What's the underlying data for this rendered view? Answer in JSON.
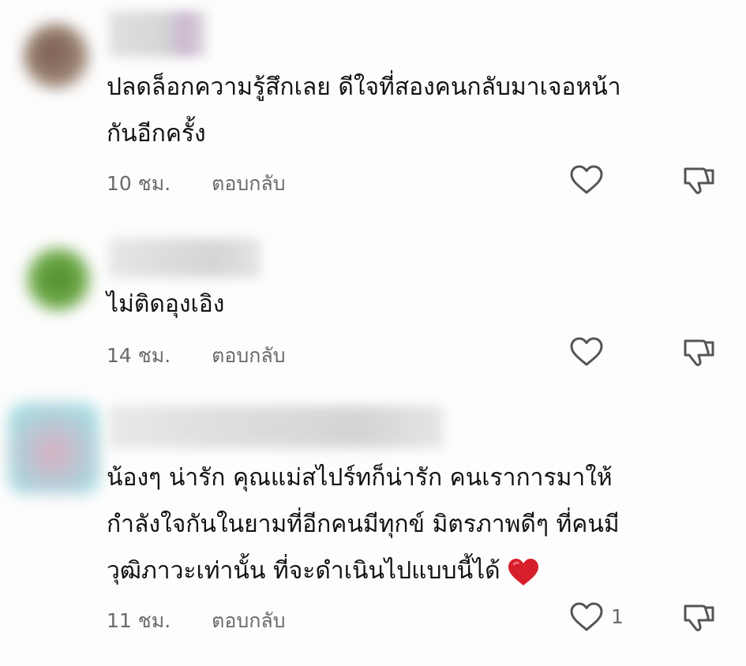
{
  "comments": [
    {
      "text_lines": [
        "ปลดล็อกความรู้สึกเลย ดีใจที่สองคนกลับมาเจอหน้า",
        "กันอีกครั้ง"
      ],
      "time": "10 ชม.",
      "reply_label": "ตอบกลับ",
      "like_count": "",
      "avatar_color": "#8a7062",
      "has_heart_emoji": false
    },
    {
      "text_lines": [
        "ไม่ติดอุงเอิง"
      ],
      "time": "14 ชม.",
      "reply_label": "ตอบกลับ",
      "like_count": "",
      "avatar_color": "#5e9a3a",
      "has_heart_emoji": false
    },
    {
      "text_lines": [
        "น้องๆ น่ารัก คุณแม่สไปร์ทก็น่ารัก คนเราการมาให้",
        "กำลังใจกันในยามที่อีกคนมีทุกข์ มิตรภาพดีๆ ที่คนมี",
        "วุฒิภาวะเท่านั้น ที่จะดำเนินไปแบบนี้ได้"
      ],
      "time": "11 ชม.",
      "reply_label": "ตอบกลับ",
      "like_count": "1",
      "avatar_color": "#a8d8df",
      "has_heart_emoji": true
    }
  ],
  "icons": {
    "like": "heart-outline-icon",
    "dislike": "thumbs-down-icon",
    "emoji": "red-heart-emoji"
  },
  "colors": {
    "text": "#121212",
    "meta": "#6a6a6a",
    "icon": "#555555",
    "heart_emoji": "#d71f2b"
  }
}
